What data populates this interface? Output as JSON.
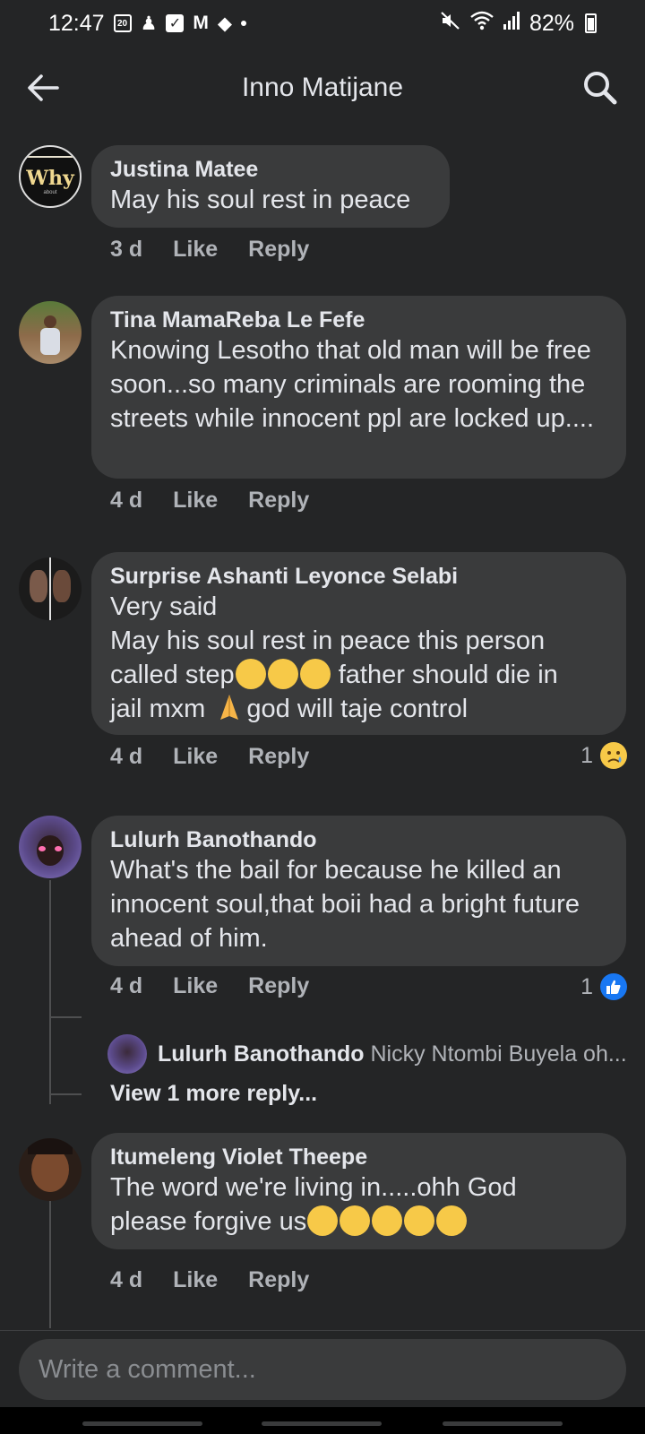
{
  "status_bar": {
    "time": "12:47",
    "battery": "82%",
    "left_icons": [
      "calendar-icon",
      "notification-icon",
      "checkbox-icon",
      "gmail-icon",
      "direction-icon"
    ],
    "right_icons": [
      "mute-icon",
      "wifi-icon",
      "signal-icon",
      "battery-icon"
    ],
    "calendar_day": "20"
  },
  "header": {
    "title": "Inno Matijane"
  },
  "comments": [
    {
      "author": "Justina Matee",
      "text": "May his soul rest in peace",
      "time": "3 d",
      "like_label": "Like",
      "reply_label": "Reply",
      "avatar_text": "Why",
      "avatar_subtext": "about"
    },
    {
      "author": "Tina MamaReba Le Fefe",
      "text": "Knowing Lesotho that old man will be free soon...so many criminals are rooming the streets while innocent ppl are locked up....",
      "time": "4 d",
      "like_label": "Like",
      "reply_label": "Reply"
    },
    {
      "author": "Surprise Ashanti Leyonce Selabi",
      "line1": "Very said",
      "line2": "May his soul rest in peace this person",
      "line3a": "called step",
      "line3b": " father should die in",
      "line4a": "jail mxm ",
      "line4b": "god will taje control",
      "time": "4 d",
      "like_label": "Like",
      "reply_label": "Reply",
      "reaction_count": "1",
      "reaction_type": "sad-face-icon"
    },
    {
      "author": "Lulurh Banothando",
      "text": "What's the bail for because he killed an innocent soul,that boii had a bright future ahead of him.",
      "time": "4 d",
      "like_label": "Like",
      "reply_label": "Reply",
      "reaction_count": "1",
      "reaction_type": "thumbs-up-icon",
      "reply_preview": {
        "author": "Lulurh Banothando",
        "text": "Nicky Ntombi Buyela oh..."
      },
      "view_more": "View 1 more reply..."
    },
    {
      "author": "Itumeleng Violet Theepe",
      "line1": "The word we're living in.....ohh God",
      "line2": "please forgive us",
      "time": "4 d",
      "like_label": "Like",
      "reply_label": "Reply"
    }
  ],
  "composer": {
    "placeholder": "Write a comment..."
  },
  "colors": {
    "background": "#242526",
    "bubble": "#3a3b3c",
    "text": "#e4e6eb",
    "muted": "#b0b3b8",
    "like_blue": "#1877f2",
    "emoji_yellow": "#f7c948"
  }
}
